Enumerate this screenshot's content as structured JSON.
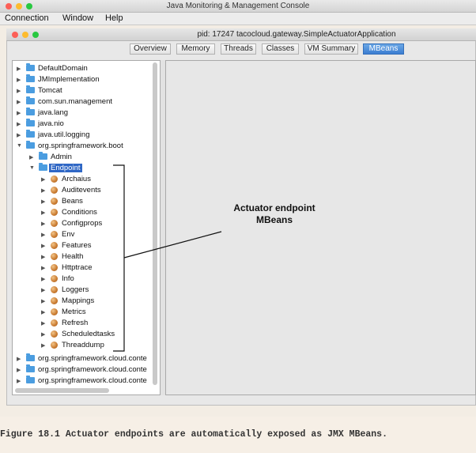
{
  "outer_window": {
    "title": "Java Monitoring & Management Console"
  },
  "menubar": {
    "items": [
      "Connection",
      "Window",
      "Help"
    ]
  },
  "inner_window": {
    "title": "pid: 17247 tacocloud.gateway.SimpleActuatorApplication"
  },
  "tabs": [
    {
      "label": "Overview",
      "active": false
    },
    {
      "label": "Memory",
      "active": false
    },
    {
      "label": "Threads",
      "active": false
    },
    {
      "label": "Classes",
      "active": false
    },
    {
      "label": "VM Summary",
      "active": false
    },
    {
      "label": "MBeans",
      "active": true
    }
  ],
  "tree": {
    "top_level": [
      "DefaultDomain",
      "JMImplementation",
      "Tomcat",
      "com.sun.management",
      "java.lang",
      "java.nio",
      "java.util.logging",
      "org.springframework.boot"
    ],
    "boot_children": [
      "Admin",
      "Endpoint"
    ],
    "selected": "Endpoint",
    "endpoints": [
      "Archaius",
      "Auditevents",
      "Beans",
      "Conditions",
      "Configprops",
      "Env",
      "Features",
      "Health",
      "Httptrace",
      "Info",
      "Loggers",
      "Mappings",
      "Metrics",
      "Refresh",
      "Scheduledtasks",
      "Threaddump"
    ],
    "bottom_items": [
      "org.springframework.cloud.conte",
      "org.springframework.cloud.conte",
      "org.springframework.cloud.conte"
    ]
  },
  "annotation": {
    "line1": "Actuator endpoint",
    "line2": "MBeans"
  },
  "caption": "Figure 18.1  Actuator endpoints are automatically exposed as JMX MBeans.",
  "colors": {
    "selection": "#2f67c5",
    "folder": "#4b9de0",
    "active_tab": "#3b7dd1"
  }
}
